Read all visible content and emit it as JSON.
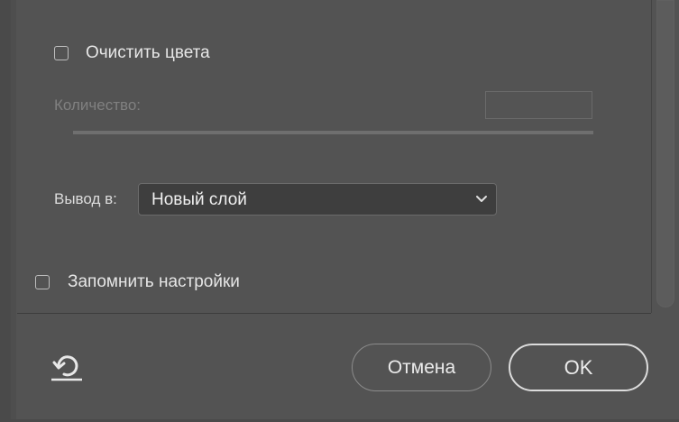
{
  "dialog": {
    "clean_colors": {
      "label": "Очистить цвета",
      "checked": false
    },
    "amount": {
      "label": "Количество:",
      "value": "",
      "enabled": false
    },
    "output": {
      "label": "Вывод в:",
      "selected": "Новый слой"
    },
    "remember_settings": {
      "label": "Запомнить настройки",
      "checked": false
    }
  },
  "footer": {
    "reset_icon": "undo-icon",
    "cancel_label": "Отмена",
    "ok_label": "OK"
  },
  "colors": {
    "background": "#535353",
    "select_background": "#3e3e3e",
    "text": "#e6e6e6",
    "disabled_text": "#808080"
  }
}
